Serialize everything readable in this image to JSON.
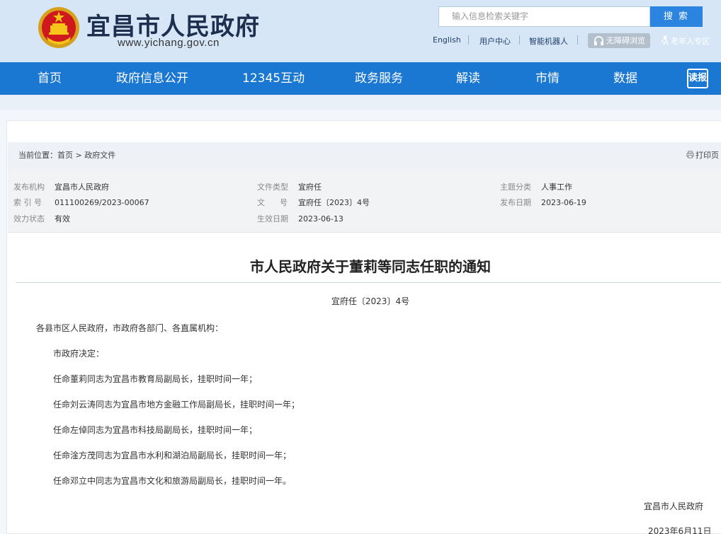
{
  "header": {
    "site_name": "宜昌市人民政府",
    "site_url": "www.yichang.gov.cn",
    "search_placeholder": "输入信息检索关键字",
    "search_button": "搜 索",
    "links": [
      "English",
      "用户中心",
      "智能机器人"
    ],
    "accessibility_label": "无障碍浏览",
    "elder_label": "老年人专区"
  },
  "nav": {
    "items": [
      "首页",
      "政府信息公开",
      "12345互动",
      "政务服务",
      "解读",
      "市情",
      "数据"
    ],
    "read_label": "读报"
  },
  "breadcrumb": {
    "prefix": "当前位置：",
    "home": "首页",
    "separator": ">",
    "current": "政府文件",
    "print_label": "打印页"
  },
  "meta": {
    "publisher_label": "发布机构",
    "publisher": "宜昌市人民政府",
    "index_label": "索 引 号",
    "index": "011100269/2023-00067",
    "status_label": "效力状态",
    "status": "有效",
    "type_label": "文件类型",
    "type": "宜府任",
    "doc_no_label": "文      号",
    "doc_no": "宜府任〔2023〕4号",
    "effective_label": "生效日期",
    "effective": "2023-06-13",
    "topic_label": "主题分类",
    "topic": "人事工作",
    "pub_date_label": "发布日期",
    "pub_date": "2023-06-19"
  },
  "document": {
    "title": "市人民政府关于董莉等同志任职的通知",
    "number": "宜府任〔2023〕4号",
    "salutation": "各县市区人民政府，市政府各部门、各直属机构：",
    "paragraphs": [
      "市政府决定：",
      "任命董莉同志为宜昌市教育局副局长，挂职时间一年；",
      "任命刘云涛同志为宜昌市地方金融工作局副局长，挂职时间一年；",
      "任命左倬同志为宜昌市科技局副局长，挂职时间一年；",
      "任命淦方茂同志为宜昌市水利和湖泊局副局长，挂职时间一年；",
      "任命邓立中同志为宜昌市文化和旅游局副局长，挂职时间一年。"
    ],
    "signature": "宜昌市人民政府",
    "sign_date": "2023年6月11日"
  },
  "colors": {
    "header_bg": "#d6e6f7",
    "nav_bg": "#1a77d2",
    "search_button": "#2a84e0",
    "title_text": "#1d2f4e"
  }
}
